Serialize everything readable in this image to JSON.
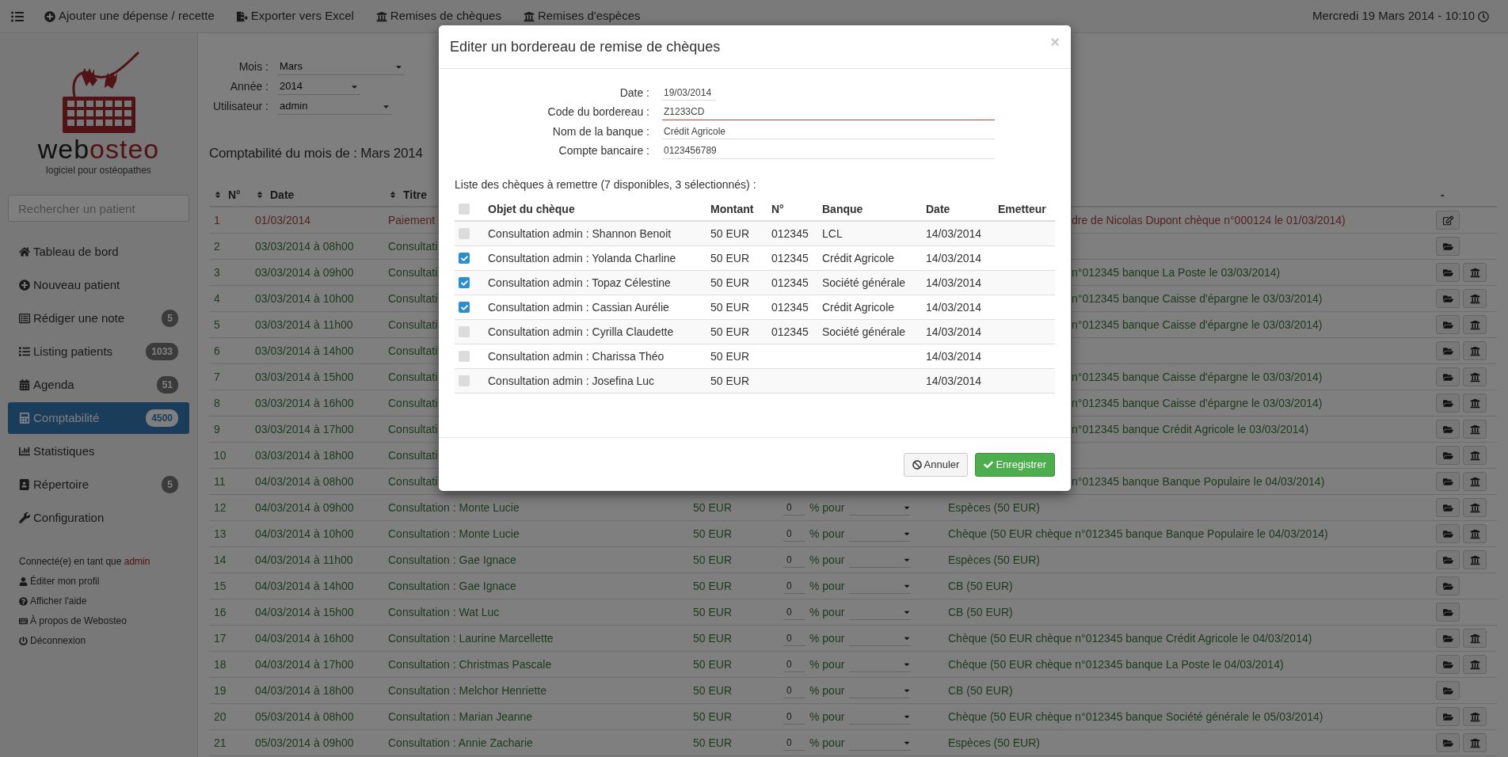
{
  "navbar": {
    "items": [
      {
        "label": "Ajouter une dépense / recette"
      },
      {
        "label": "Exporter vers Excel"
      },
      {
        "label": "Remises de chèques"
      },
      {
        "label": "Remises d'espèces"
      }
    ],
    "datetime": "Mercredi 19 Mars 2014 - 10:10"
  },
  "sidebar": {
    "brand": {
      "name_part_1": "web",
      "name_part_2": "osteo",
      "tagline": "logiciel pour ostéopathes"
    },
    "search": {
      "placeholder": "Rechercher un patient"
    },
    "items": [
      {
        "label": "Tableau de bord",
        "selected": false
      },
      {
        "label": "Nouveau patient",
        "selected": false
      },
      {
        "label": "Rédiger une note",
        "badge": "5",
        "selected": false
      },
      {
        "label": "Listing patients",
        "badge": "1033",
        "selected": false
      },
      {
        "label": "Agenda",
        "badge": "51",
        "selected": false
      },
      {
        "label": "Comptabilité",
        "badge": "4500",
        "selected": true
      },
      {
        "label": "Statistiques",
        "selected": false
      },
      {
        "label": "Répertoire",
        "badge": "5",
        "selected": false
      },
      {
        "label": "Configuration",
        "selected": false
      }
    ],
    "user": {
      "prefix": "Connecté(e) en tant que",
      "name": "admin"
    },
    "links": [
      {
        "label": "Éditer mon profil"
      },
      {
        "label": "Afficher l'aide"
      },
      {
        "label": "À propos de Webosteo"
      },
      {
        "label": "Déconnexion"
      }
    ]
  },
  "filters": [
    {
      "label": "Mois :",
      "value": "Mars"
    },
    {
      "label": "Année :",
      "value": "2014"
    },
    {
      "label": "Utilisateur :",
      "value": "admin"
    }
  ],
  "heading": "Comptabilité du mois de : Mars 2014",
  "table": {
    "columns": [
      {
        "label": "N°",
        "sortable": true
      },
      {
        "label": "Date",
        "sortable": true
      },
      {
        "label": "Titre",
        "sortable": true
      },
      {
        "label": "-",
        "sortable": false
      }
    ],
    "rows": [
      {
        "number": "1",
        "date": "01/03/2014",
        "title": "Paiement",
        "kind": "expense",
        "description": "dre de Nicolas Dupont chèque n°000124 le 01/03/2014)",
        "actions": [
          {
            "kind": "edit"
          }
        ]
      },
      {
        "number": "2",
        "date": "03/03/2014 à 08h00",
        "title": "Consultati",
        "kind": "income",
        "actions": [
          {
            "kind": "folder"
          }
        ]
      },
      {
        "number": "3",
        "date": "03/03/2014 à 09h00",
        "title": "Consultati",
        "kind": "income",
        "description": "n°012345 banque La Poste le 03/03/2014)",
        "actions": [
          {
            "kind": "folder"
          },
          {
            "kind": "bank"
          }
        ]
      },
      {
        "number": "4",
        "date": "03/03/2014 à 10h00",
        "title": "Consultati",
        "kind": "income",
        "description": "n°012345 banque Caisse d'épargne le 03/03/2014)",
        "actions": [
          {
            "kind": "folder"
          },
          {
            "kind": "bank"
          }
        ]
      },
      {
        "number": "5",
        "date": "03/03/2014 à 11h00",
        "title": "Consultati",
        "kind": "income",
        "description": "n°012345 banque Caisse d'épargne le 03/03/2014)",
        "actions": [
          {
            "kind": "folder"
          },
          {
            "kind": "bank"
          }
        ]
      },
      {
        "number": "6",
        "date": "03/03/2014 à 14h00",
        "title": "Consultati",
        "kind": "income",
        "actions": [
          {
            "kind": "folder"
          },
          {
            "kind": "bank"
          }
        ]
      },
      {
        "number": "7",
        "date": "03/03/2014 à 15h00",
        "title": "Consultati",
        "kind": "income",
        "description": "n°012345 banque Caisse d'épargne le 03/03/2014)",
        "actions": [
          {
            "kind": "folder"
          },
          {
            "kind": "bank"
          }
        ]
      },
      {
        "number": "8",
        "date": "03/03/2014 à 16h00",
        "title": "Consultati",
        "kind": "income",
        "description": "n°012345 banque Caisse d'épargne le 03/03/2014)",
        "actions": [
          {
            "kind": "folder"
          },
          {
            "kind": "bank"
          }
        ]
      },
      {
        "number": "9",
        "date": "03/03/2014 à 17h00",
        "title": "Consultati",
        "kind": "income",
        "description": "n°012345 banque Crédit Agricole le 03/03/2014)",
        "actions": [
          {
            "kind": "folder"
          },
          {
            "kind": "bank"
          }
        ]
      },
      {
        "number": "10",
        "date": "03/03/2014 à 18h00",
        "title": "Consultati",
        "kind": "income",
        "actions": [
          {
            "kind": "folder"
          },
          {
            "kind": "bank"
          }
        ]
      },
      {
        "number": "11",
        "date": "04/03/2014 à 08h00",
        "title": "Consultati",
        "kind": "income",
        "description": "n°012345 banque Banque Populaire le 04/03/2014)",
        "actions": [
          {
            "kind": "folder"
          },
          {
            "kind": "bank"
          }
        ]
      },
      {
        "number": "12",
        "date": "04/03/2014 à 09h00",
        "title": "Consultation : Monte Lucie",
        "kind": "income",
        "amount": "50 EUR",
        "percent": "0",
        "percent_label": "% pour",
        "description": "Espèces (50 EUR)",
        "actions": [
          {
            "kind": "folder"
          },
          {
            "kind": "bank"
          }
        ]
      },
      {
        "number": "13",
        "date": "04/03/2014 à 10h00",
        "title": "Consultation : Monte Lucie",
        "kind": "income",
        "amount": "50 EUR",
        "percent": "0",
        "percent_label": "% pour",
        "description": "Chèque (50 EUR chèque n°012345 banque Banque Populaire le 04/03/2014)",
        "actions": [
          {
            "kind": "folder"
          },
          {
            "kind": "bank"
          }
        ]
      },
      {
        "number": "14",
        "date": "04/03/2014 à 11h00",
        "title": "Consultation : Gae Ignace",
        "kind": "income",
        "amount": "50 EUR",
        "percent": "0",
        "percent_label": "% pour",
        "description": "Espèces (50 EUR)",
        "actions": [
          {
            "kind": "folder"
          },
          {
            "kind": "bank"
          }
        ]
      },
      {
        "number": "15",
        "date": "04/03/2014 à 14h00",
        "title": "Consultation : Gae Ignace",
        "kind": "income",
        "amount": "50 EUR",
        "percent": "0",
        "percent_label": "% pour",
        "description": "CB (50 EUR)",
        "actions": [
          {
            "kind": "folder"
          }
        ]
      },
      {
        "number": "16",
        "date": "04/03/2014 à 15h00",
        "title": "Consultation : Wat Luc",
        "kind": "income",
        "amount": "50 EUR",
        "percent": "0",
        "percent_label": "% pour",
        "description": "CB (50 EUR)",
        "actions": [
          {
            "kind": "folder"
          }
        ]
      },
      {
        "number": "17",
        "date": "04/03/2014 à 16h00",
        "title": "Consultation : Laurine Marcellette",
        "kind": "income",
        "amount": "50 EUR",
        "percent": "0",
        "percent_label": "% pour",
        "description": "Chèque (50 EUR chèque n°012345 banque Crédit Agricole le 04/03/2014)",
        "actions": [
          {
            "kind": "folder"
          },
          {
            "kind": "bank"
          }
        ]
      },
      {
        "number": "18",
        "date": "04/03/2014 à 17h00",
        "title": "Consultation : Christmas Pascale",
        "kind": "income",
        "amount": "50 EUR",
        "percent": "0",
        "percent_label": "% pour",
        "description": "Chèque (50 EUR chèque n°012345 banque La Poste le 04/03/2014)",
        "actions": [
          {
            "kind": "folder"
          },
          {
            "kind": "bank"
          }
        ]
      },
      {
        "number": "19",
        "date": "04/03/2014 à 18h00",
        "title": "Consultation : Melchor Henriette",
        "kind": "income",
        "amount": "50 EUR",
        "percent": "0",
        "percent_label": "% pour",
        "description": "CB (50 EUR)",
        "actions": [
          {
            "kind": "folder"
          }
        ]
      },
      {
        "number": "20",
        "date": "05/03/2014 à 08h00",
        "title": "Consultation : Marian Jeanne",
        "kind": "income",
        "amount": "50 EUR",
        "percent": "0",
        "percent_label": "% pour",
        "description": "Chèque (50 EUR chèque n°012345 banque Société générale le 05/03/2014)",
        "actions": [
          {
            "kind": "folder"
          },
          {
            "kind": "bank"
          }
        ]
      },
      {
        "number": "21",
        "date": "05/03/2014 à 09h00",
        "title": "Consultation : Annie Zacharie",
        "kind": "income",
        "amount": "50 EUR",
        "percent": "0",
        "percent_label": "% pour",
        "description": "Espèces (50 EUR)",
        "actions": [
          {
            "kind": "folder"
          },
          {
            "kind": "bank"
          }
        ]
      }
    ]
  },
  "modal": {
    "title": "Editer un bordereau de remise de chèques",
    "close": "×",
    "form": [
      {
        "label": "Date :",
        "value": "19/03/2014",
        "invalid": false
      },
      {
        "label": "Code du bordereau :",
        "value": "Z1233CD",
        "invalid": true
      },
      {
        "label": "Nom de la banque :",
        "value": "Crédit Agricole",
        "invalid": false
      },
      {
        "label": "Compte bancaire :",
        "value": "0123456789",
        "invalid": false
      }
    ],
    "list_caption": "Liste des chèques à remettre (7 disponibles, 3 sélectionnés) :",
    "select_all": {
      "checked": false
    },
    "columns": [
      "Objet du chèque",
      "Montant",
      "N°",
      "Banque",
      "Date",
      "Emetteur"
    ],
    "rows": [
      {
        "checked": false,
        "object": "Consultation admin : Shannon Benoit",
        "amount": "50 EUR",
        "number": "012345",
        "bank": "LCL",
        "date": "14/03/2014"
      },
      {
        "checked": true,
        "object": "Consultation admin : Yolanda Charline",
        "amount": "50 EUR",
        "number": "012345",
        "bank": "Crédit Agricole",
        "date": "14/03/2014"
      },
      {
        "checked": true,
        "object": "Consultation admin : Topaz Célestine",
        "amount": "50 EUR",
        "number": "012345",
        "bank": "Société générale",
        "date": "14/03/2014"
      },
      {
        "checked": true,
        "object": "Consultation admin : Cassian Aurélie",
        "amount": "50 EUR",
        "number": "012345",
        "bank": "Crédit Agricole",
        "date": "14/03/2014"
      },
      {
        "checked": false,
        "object": "Consultation admin : Cyrilla Claudette",
        "amount": "50 EUR",
        "number": "012345",
        "bank": "Société générale",
        "date": "14/03/2014"
      },
      {
        "checked": false,
        "object": "Consultation admin : Charissa Théo",
        "amount": "50 EUR",
        "date": "14/03/2014"
      },
      {
        "checked": false,
        "object": "Consultation admin : Josefina Luc",
        "amount": "50 EUR",
        "date": "14/03/2014"
      }
    ],
    "buttons": [
      {
        "label": "Annuler",
        "kind": "default"
      },
      {
        "label": "Enregistrer",
        "kind": "primary"
      }
    ]
  }
}
